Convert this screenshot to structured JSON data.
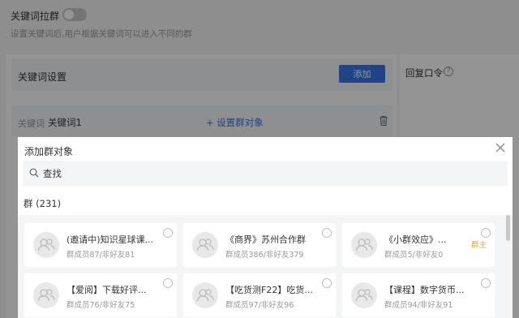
{
  "page": {
    "keyword_group_title": "关键词拉群",
    "keyword_group_desc": "设置关键词后,用户根据关键词可以进入不同的群",
    "keyword_settings_title": "关键词设置",
    "add_button": "添加",
    "reply_password_label": "回复口令",
    "keyword_label": "关键词",
    "keyword_value": "关键词1",
    "set_group_target": "+  设置群对象"
  },
  "dialog": {
    "title": "添加群对象",
    "search_placeholder": "查找",
    "group_count": "群 (231)",
    "groups": [
      {
        "name": "(邀请中)知识星球课...",
        "meta": "群成员87/非好友81",
        "owner": ""
      },
      {
        "name": "《商界》苏州合作群",
        "meta": "群成员386/非好友379",
        "owner": ""
      },
      {
        "name": "《小群效应》...",
        "meta": "群成员5/非好友0",
        "owner": "群主"
      },
      {
        "name": "【爱阅】下载好评...",
        "meta": "群成员76/非好友75",
        "owner": ""
      },
      {
        "name": "【吃货测F22】吃货...",
        "meta": "群成员97/非好友96",
        "owner": ""
      },
      {
        "name": "【课程】数字货币...",
        "meta": "群成员94/非好友91",
        "owner": ""
      }
    ]
  },
  "colors": {
    "accent": "#3b74e6",
    "owner_tag": "#e8a23a"
  }
}
